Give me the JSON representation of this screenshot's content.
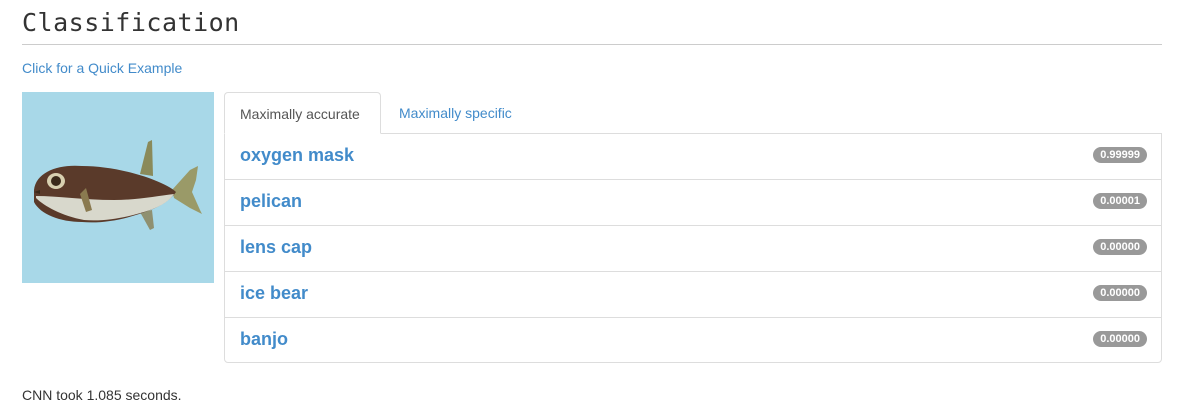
{
  "page": {
    "title": "Classification",
    "quick_example_link": "Click for a Quick Example"
  },
  "image": {
    "subject": "fish",
    "background_color": "#a8d8e8"
  },
  "tabs": [
    {
      "label": "Maximally accurate",
      "active": true
    },
    {
      "label": "Maximally specific",
      "active": false
    }
  ],
  "results": [
    {
      "label": "oxygen mask",
      "score": "0.99999"
    },
    {
      "label": "pelican",
      "score": "0.00001"
    },
    {
      "label": "lens cap",
      "score": "0.00000"
    },
    {
      "label": "ice bear",
      "score": "0.00000"
    },
    {
      "label": "banjo",
      "score": "0.00000"
    }
  ],
  "footer": {
    "timing_text": "CNN took 1.085 seconds."
  },
  "colors": {
    "link": "#428bca",
    "badge": "#999999",
    "border": "#dddddd"
  }
}
